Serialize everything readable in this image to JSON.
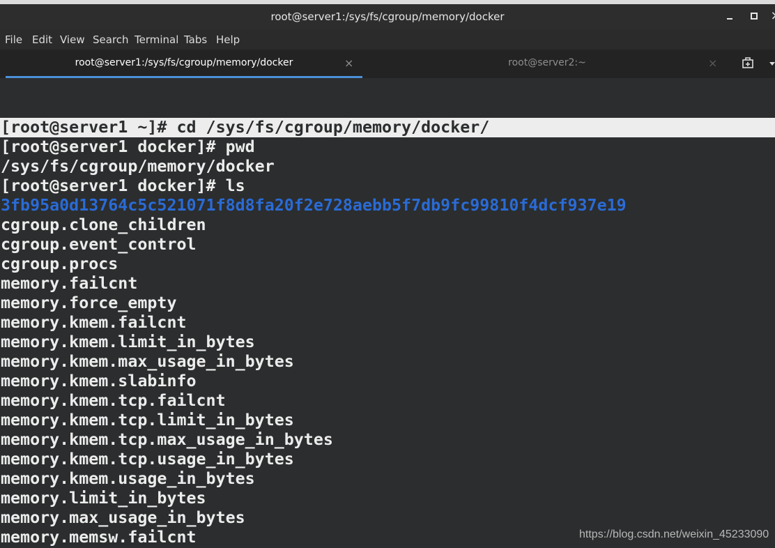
{
  "window": {
    "title": "root@server1:/sys/fs/cgroup/memory/docker",
    "close_glyph": "×"
  },
  "menu": [
    "File",
    "Edit",
    "View",
    "Search",
    "Terminal",
    "Tabs",
    "Help"
  ],
  "tabs": [
    {
      "label": "root@server1:/sys/fs/cgroup/memory/docker",
      "active": true,
      "close": "×"
    },
    {
      "label": "root@server2:~",
      "active": false,
      "close": "×"
    }
  ],
  "icons": {
    "new_tab": "new-tab-icon",
    "tab_menu": "chevron-down-icon"
  },
  "terminal": {
    "lines": [
      "[root@server1 ~]# cd /sys/fs/cgroup/memory/docker/",
      "[root@server1 docker]# pwd",
      "/sys/fs/cgroup/memory/docker",
      "[root@server1 docker]# ls",
      "3fb95a0d13764c5c521071f8d8fa20f2e728aebb5f7db9fc99810f4dcf937e19",
      "cgroup.clone_children",
      "cgroup.event_control",
      "cgroup.procs",
      "memory.failcnt",
      "memory.force_empty",
      "memory.kmem.failcnt",
      "memory.kmem.limit_in_bytes",
      "memory.kmem.max_usage_in_bytes",
      "memory.kmem.slabinfo",
      "memory.kmem.tcp.failcnt",
      "memory.kmem.tcp.limit_in_bytes",
      "memory.kmem.tcp.max_usage_in_bytes",
      "memory.kmem.tcp.usage_in_bytes",
      "memory.kmem.usage_in_bytes",
      "memory.limit_in_bytes",
      "memory.max_usage_in_bytes",
      "memory.memsw.failcnt"
    ],
    "highlighted_line": 0,
    "directory_line": 4
  },
  "colors": {
    "terminal_bg": "#2b2d2e",
    "terminal_fg": "#ececec",
    "directory": "#2a6bd6",
    "tab_accent": "#4a90d9",
    "selection_bg": "#ededed"
  },
  "watermark": "https://blog.csdn.net/weixin_45233090"
}
